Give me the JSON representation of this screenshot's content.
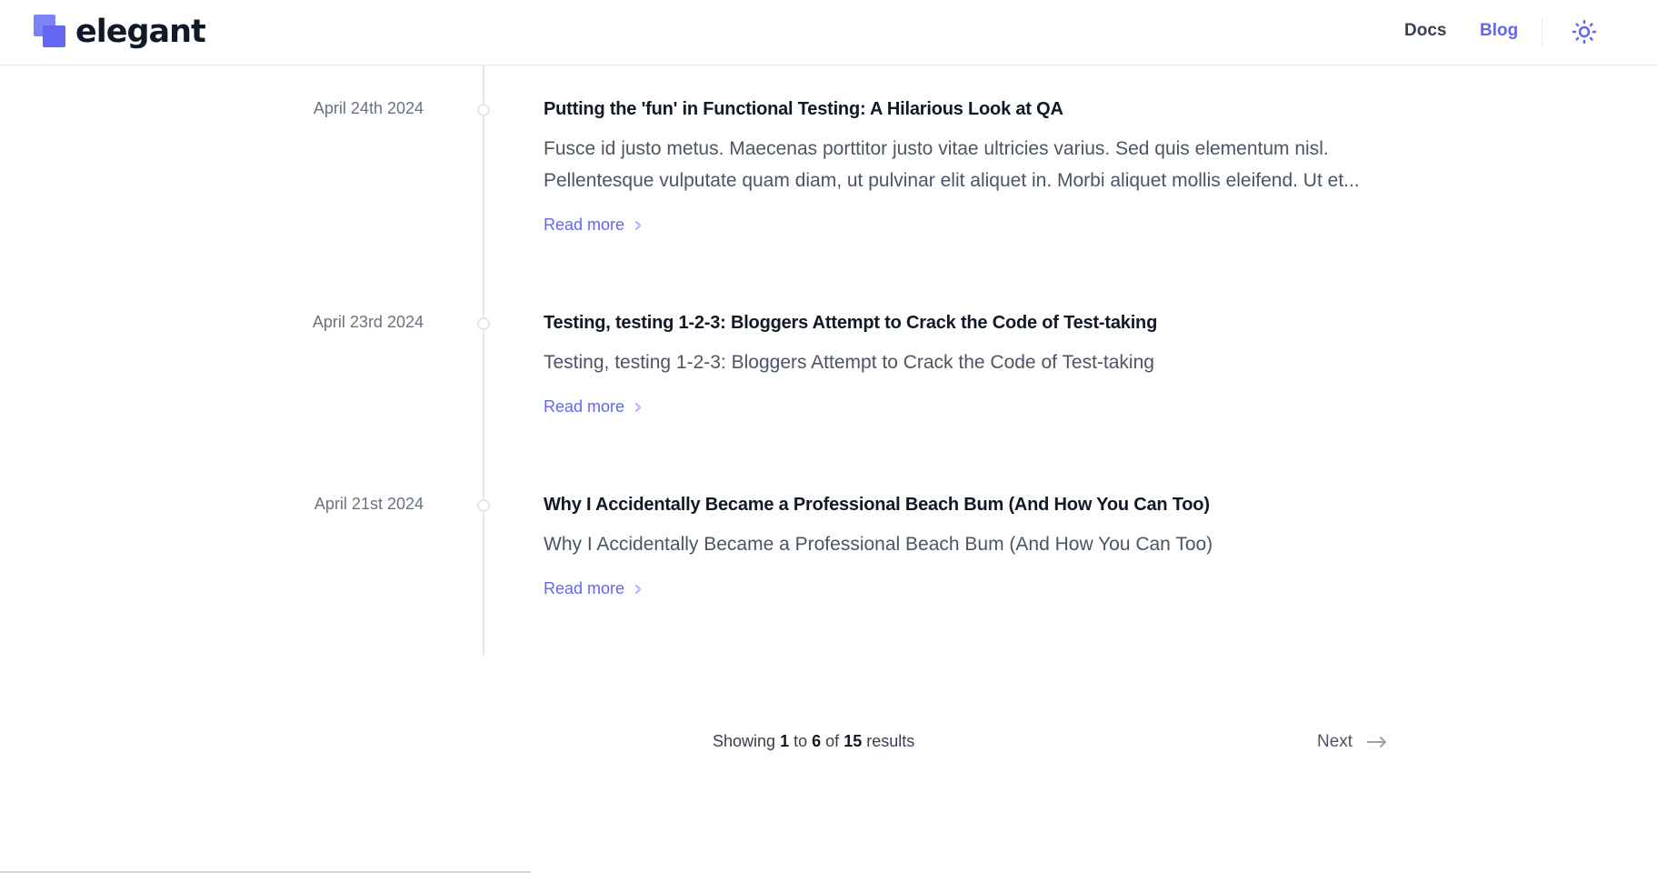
{
  "brand": {
    "name": "elegant",
    "accent": "#6366f1"
  },
  "nav": {
    "docs_label": "Docs",
    "blog_label": "Blog",
    "theme_icon": "sun-icon"
  },
  "posts": [
    {
      "date": "April 24th 2024",
      "title": "Putting the 'fun' in Functional Testing: A Hilarious Look at QA",
      "excerpt": "Fusce id justo metus. Maecenas porttitor justo vitae ultricies varius. Sed quis elementum nisl. Pellentesque vulputate quam diam, ut pulvinar elit aliquet in. Morbi aliquet mollis eleifend. Ut et...",
      "read_more": "Read more"
    },
    {
      "date": "April 23rd 2024",
      "title": "Testing, testing 1-2-3: Bloggers Attempt to Crack the Code of Test-taking",
      "excerpt": "Testing, testing 1-2-3: Bloggers Attempt to Crack the Code of Test-taking",
      "read_more": "Read more"
    },
    {
      "date": "April 21st 2024",
      "title": "Why I Accidentally Became a Professional Beach Bum (And How You Can Too)",
      "excerpt": "Why I Accidentally Became a Professional Beach Bum (And How You Can Too)",
      "read_more": "Read more"
    }
  ],
  "pagination": {
    "showing_prefix": "Showing",
    "from": "1",
    "to_word": "to",
    "to": "6",
    "of_word": "of",
    "total": "15",
    "results_word": "results",
    "next_label": "Next"
  }
}
